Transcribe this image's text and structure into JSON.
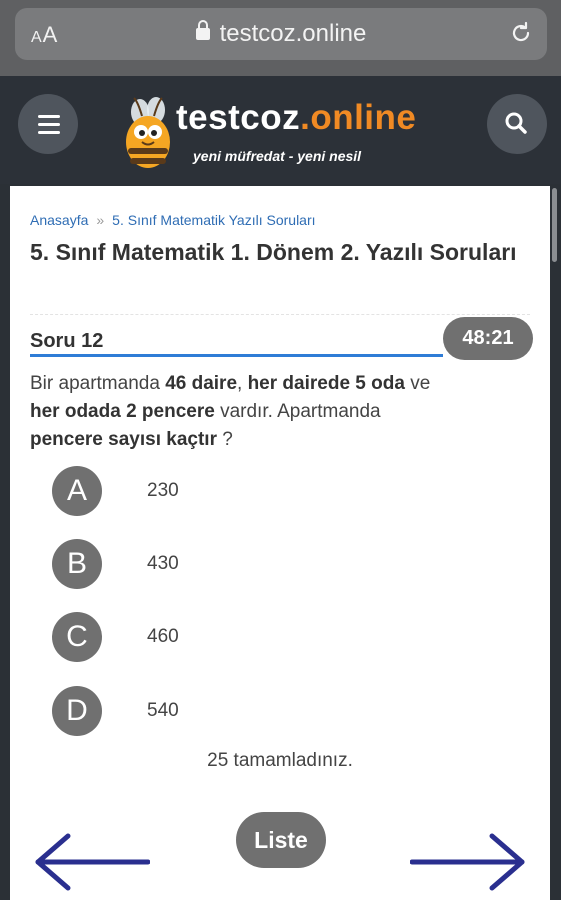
{
  "browser": {
    "text_size_label_small": "A",
    "text_size_label_large": "A",
    "url": "testcoz.online"
  },
  "header": {
    "logo_word": "testcoz",
    "logo_accent": ".online",
    "tagline": "yeni müfredat - yeni nesil"
  },
  "breadcrumb": {
    "home": "Anasayfa",
    "separator": "»",
    "current": "5. Sınıf Matematik Yazılı Soruları"
  },
  "page_title": "5. Sınıf Matematik 1. Dönem 2. Yazılı Soruları",
  "question": {
    "title": "Soru 12",
    "timer": "48:21",
    "text_parts": [
      "Bir apartmanda ",
      "46 daire",
      ", ",
      "her dairede 5 oda",
      " ve ",
      "her odada 2 pencere",
      " vardır. Apartmanda ",
      "pencere sayısı kaçtır",
      " ?"
    ]
  },
  "options": [
    {
      "letter": "A",
      "value": "230"
    },
    {
      "letter": "B",
      "value": "430"
    },
    {
      "letter": "C",
      "value": "460"
    },
    {
      "letter": "D",
      "value": "540"
    }
  ],
  "progress_text": "25 tamamladınız.",
  "nav": {
    "list_label": "Liste",
    "prev_icon": "arrow-left-icon",
    "next_icon": "arrow-right-icon"
  },
  "colors": {
    "accent_orange": "#f08a24",
    "link_blue": "#2f6db4",
    "underline_blue": "#2f7cd6",
    "arrow_navy": "#2a2f8f",
    "button_gray": "#707070"
  }
}
